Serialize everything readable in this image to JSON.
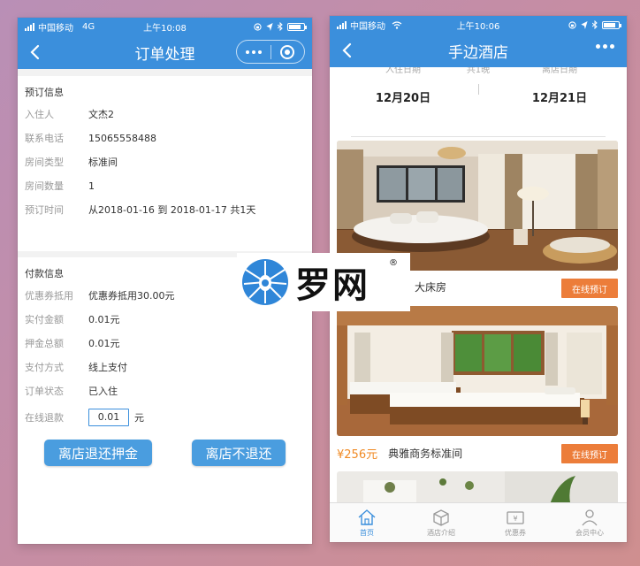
{
  "left": {
    "status": {
      "carrier": "中国移动",
      "network": "4G",
      "time": "上午10:08"
    },
    "nav": {
      "title": "订单处理"
    },
    "booking": {
      "title": "预订信息",
      "rows": [
        {
          "key": "入住人",
          "value": "文杰2"
        },
        {
          "key": "联系电话",
          "value": "15065558488"
        },
        {
          "key": "房间类型",
          "value": "标准间"
        },
        {
          "key": "房间数量",
          "value": "1"
        },
        {
          "key": "预订时间",
          "value": "从2018-01-16 到 2018-01-17 共1天"
        }
      ]
    },
    "payment": {
      "title": "付款信息",
      "rows": [
        {
          "key": "优惠券抵用",
          "value": "优惠券抵用30.00元"
        },
        {
          "key": "实付金额",
          "value": "0.01元"
        },
        {
          "key": "押金总额",
          "value": "0.01元"
        },
        {
          "key": "支付方式",
          "value": "线上支付"
        },
        {
          "key": "订单状态",
          "value": "已入住"
        }
      ],
      "refund": {
        "key": "在线退款",
        "value": "0.01",
        "unit": "元"
      }
    },
    "buttons": {
      "checkout_refund": "离店退还押金",
      "checkout_no_refund": "离店不退还"
    }
  },
  "right": {
    "status": {
      "carrier": "中国移动",
      "time": "上午10:06"
    },
    "nav": {
      "title": "手边酒店"
    },
    "dates": {
      "checkin_label": "入住日期",
      "checkin": "12月20日",
      "nights_label": "共1晚",
      "checkout_label": "离店日期",
      "checkout": "12月21日"
    },
    "rooms": [
      {
        "price": "",
        "name": "大床房",
        "book": "在线预订"
      },
      {
        "price": "¥256元",
        "name": "典雅商务标准间",
        "book": "在线预订"
      }
    ],
    "tabs": [
      {
        "label": "首页",
        "icon": "home-icon",
        "active": true
      },
      {
        "label": "酒店介绍",
        "icon": "box-icon",
        "active": false
      },
      {
        "label": "优惠券",
        "icon": "coupon-icon",
        "active": false
      },
      {
        "label": "会员中心",
        "icon": "user-icon",
        "active": false
      }
    ]
  },
  "watermark": {
    "text": "罗网",
    "reg": "®"
  },
  "colors": {
    "primary": "#3b8fdc",
    "accent": "#ec7d3a",
    "price": "#f08a24"
  }
}
